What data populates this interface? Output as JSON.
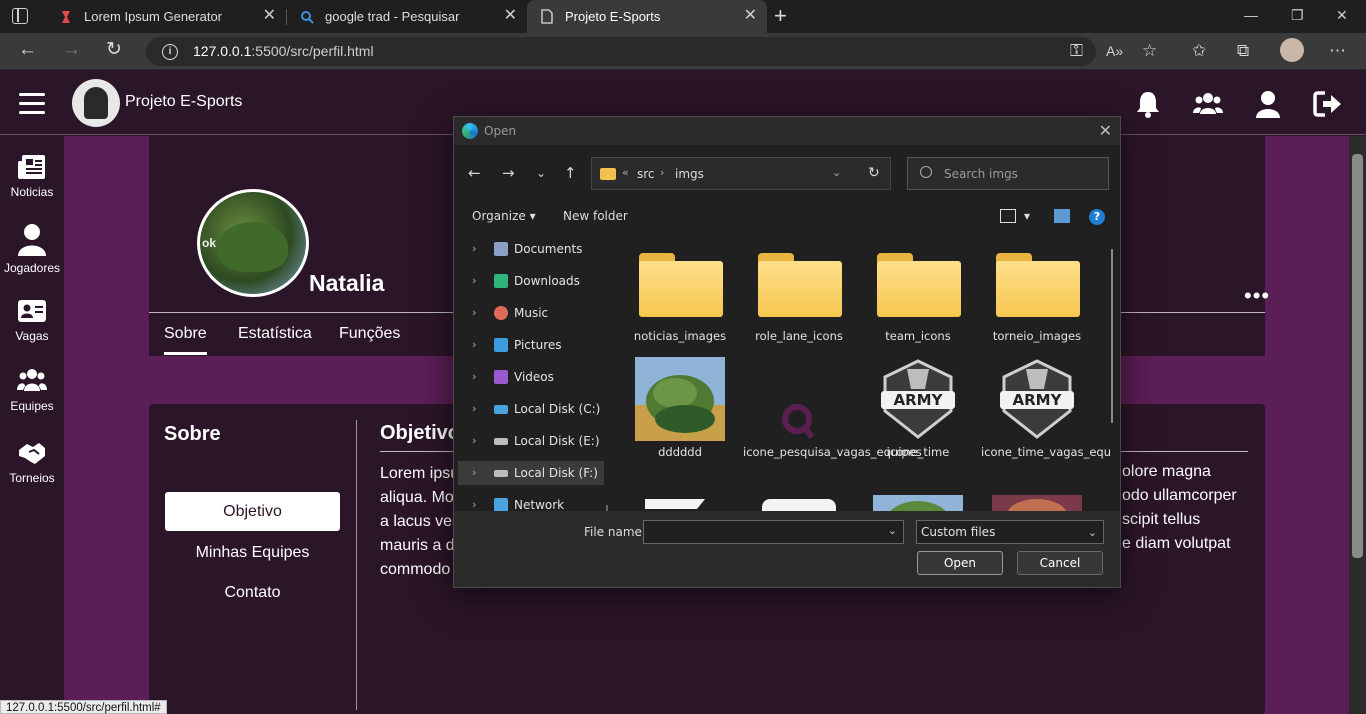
{
  "browser": {
    "tabs": [
      {
        "title": "Lorem Ipsum Generator"
      },
      {
        "title": "google trad - Pesquisar"
      },
      {
        "title": "Projeto E-Sports"
      }
    ],
    "url_host": "127.0.0.1",
    "url_path": ":5500/src/perfil.html",
    "status_url": "127.0.0.1:5500/src/perfil.html#"
  },
  "site": {
    "brand": "Projeto E-Sports",
    "sidebar": [
      {
        "label": "Noticias"
      },
      {
        "label": "Jogadores"
      },
      {
        "label": "Vagas"
      },
      {
        "label": "Equipes"
      },
      {
        "label": "Torneios"
      }
    ],
    "profile_name": "Natalia",
    "avatar_text": "ok",
    "profile_tabs": [
      "Sobre",
      "Estatística",
      "Funções"
    ],
    "section_title": "Sobre",
    "section_buttons": [
      "Objetivo",
      "Minhas Equipes",
      "Contato"
    ],
    "content_heading": "Objetivo",
    "lorem_left": [
      "Lorem ipsu",
      "aliqua. Mo",
      "a lacus ves",
      "mauris a d",
      "commodo"
    ],
    "lorem_right": [
      "olore magna",
      "odo ullamcorper",
      "scipit tellus",
      "e diam volutpat"
    ]
  },
  "dialog": {
    "title": "Open",
    "path": [
      "src",
      "imgs"
    ],
    "search_placeholder": "Search imgs",
    "organize": "Organize",
    "new_folder": "New folder",
    "tree": [
      {
        "label": "Documents",
        "icon": "documents-icon",
        "color": "#8aa0c8"
      },
      {
        "label": "Downloads",
        "icon": "downloads-icon",
        "color": "#2fb37a"
      },
      {
        "label": "Music",
        "icon": "music-icon",
        "color": "#e06a5a"
      },
      {
        "label": "Pictures",
        "icon": "pictures-icon",
        "color": "#3d9be0"
      },
      {
        "label": "Videos",
        "icon": "videos-icon",
        "color": "#9b59d0"
      },
      {
        "label": "Local Disk (C:)",
        "icon": "drive-c-icon",
        "color": "#4aa3e0"
      },
      {
        "label": "Local Disk (E:)",
        "icon": "drive-e-icon",
        "color": "#bdbdbd"
      },
      {
        "label": "Local Disk (F:)",
        "icon": "drive-f-icon",
        "color": "#bdbdbd"
      },
      {
        "label": "Network",
        "icon": "network-icon",
        "color": "#4aa3e0"
      }
    ],
    "files": [
      {
        "name": "noticias_images",
        "kind": "folder"
      },
      {
        "name": "role_lane_icons",
        "kind": "folder"
      },
      {
        "name": "team_icons",
        "kind": "folder"
      },
      {
        "name": "torneio_images",
        "kind": "folder"
      },
      {
        "name": "dddddd",
        "kind": "image"
      },
      {
        "name": "icone_pesquisa_vagas_equipes",
        "kind": "image"
      },
      {
        "name": "icone_time",
        "kind": "image"
      },
      {
        "name": "icone_time_vagas_equipes",
        "kind": "image"
      }
    ],
    "file_name_label": "File name:",
    "file_name_value": "",
    "file_type": "Custom files",
    "open": "Open",
    "cancel": "Cancel",
    "army_text": "ARMY"
  }
}
